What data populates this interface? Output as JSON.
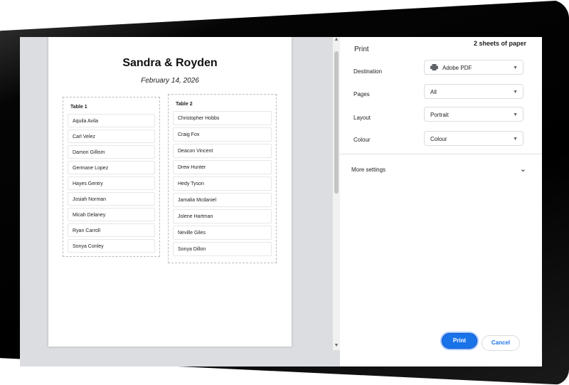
{
  "preview": {
    "couple": "Sandra & Royden",
    "date": "February 14, 2026",
    "tables": [
      {
        "title": "Table 1",
        "guests": [
          "Aquila Avila",
          "Carl Velez",
          "Damon Gillism",
          "Germane Lopez",
          "Hayes Gentry",
          "Josiah Norman",
          "Micah Delaney",
          "Ryan Carroll",
          "Sonya Conley"
        ]
      },
      {
        "title": "Table 2",
        "guests": [
          "Christopher Hobbs",
          "Craig Fox",
          "Deacon Vincent",
          "Drew Hunter",
          "Hedy Tyson",
          "Jamalia Mcdaniel",
          "Jolene Hartman",
          "Neville Giles",
          "Sonya Dillon"
        ]
      }
    ]
  },
  "settings": {
    "title": "Print",
    "sheets": "2 sheets of paper",
    "destination_label": "Destination",
    "destination_value": "Adobe PDF",
    "pages_label": "Pages",
    "pages_value": "All",
    "layout_label": "Layout",
    "layout_value": "Portrait",
    "colour_label": "Colour",
    "colour_value": "Colour",
    "more_settings": "More settings",
    "print_button": "Print",
    "cancel_button": "Cancel"
  },
  "icons": {
    "printer": "printer-icon",
    "caret": "chevron-down-icon"
  },
  "colors": {
    "accent": "#1a73e8"
  }
}
